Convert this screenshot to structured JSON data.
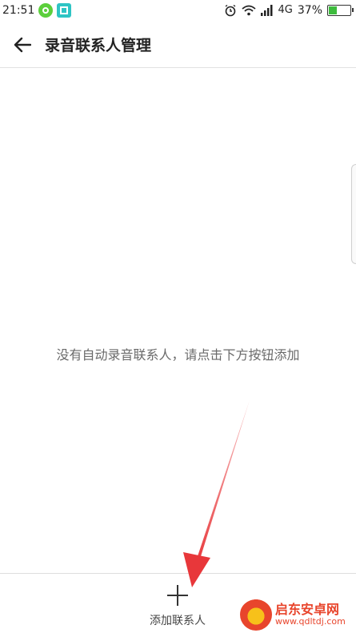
{
  "status_bar": {
    "time": "21:51",
    "network": "4G",
    "battery_percent": "37%",
    "battery_level": 0.37,
    "icons": [
      "green-app-icon",
      "teal-scan-icon",
      "alarm-icon",
      "wifi-icon",
      "signal-icon",
      "battery-icon"
    ]
  },
  "header": {
    "back_icon": "arrow-left-icon",
    "title": "录音联系人管理"
  },
  "main": {
    "empty_message": "没有自动录音联系人，请点击下方按钮添加"
  },
  "bottom_bar": {
    "add_icon": "plus-icon",
    "add_label": "添加联系人"
  },
  "annotation": {
    "arrow_color": "#e8373a"
  },
  "watermark": {
    "name": "启东安卓网",
    "url": "www.qdltdj.com"
  }
}
